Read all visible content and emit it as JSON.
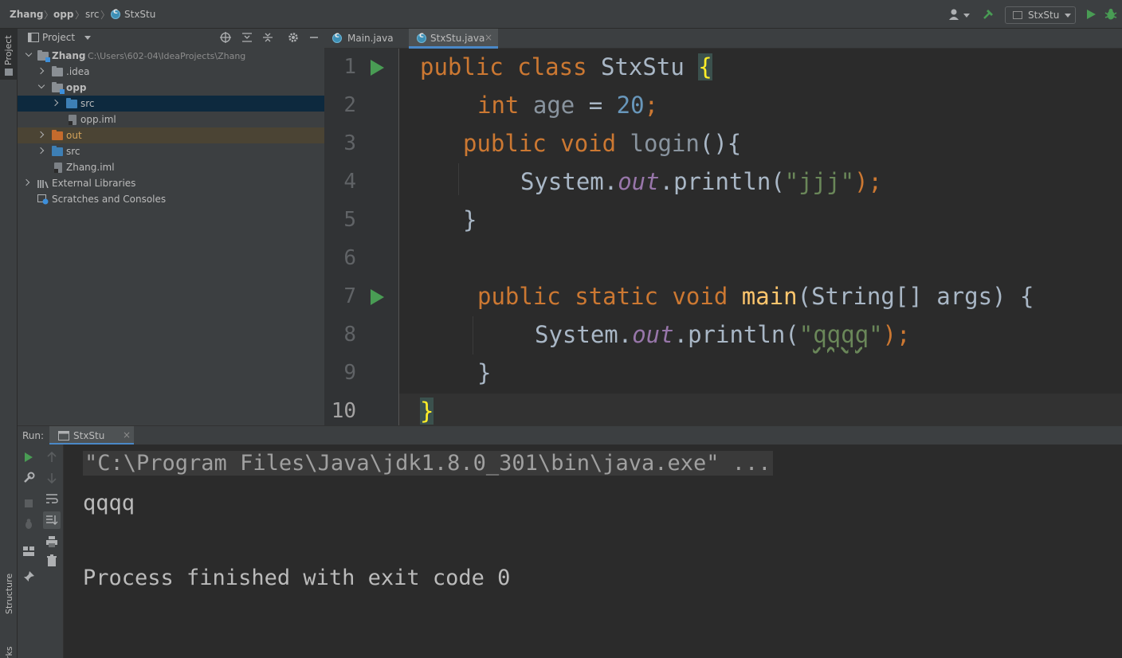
{
  "breadcrumb": {
    "items": [
      "Zhang",
      "opp",
      "src",
      "StxStu"
    ]
  },
  "toolbar": {
    "run_config": "StxStu"
  },
  "left_strip": {
    "project_tab": "Project",
    "structure_tab": "Structure",
    "bookmarks_tab": "rks"
  },
  "project_panel": {
    "title": "Project",
    "tree": [
      {
        "label": "Zhang",
        "path": "C:\\Users\\602-04\\IdeaProjects\\Zhang"
      },
      {
        "label": ".idea"
      },
      {
        "label": "opp"
      },
      {
        "label": "src"
      },
      {
        "label": "opp.iml"
      },
      {
        "label": "out"
      },
      {
        "label": "src"
      },
      {
        "label": "Zhang.iml"
      },
      {
        "label": "External Libraries"
      },
      {
        "label": "Scratches and Consoles"
      }
    ]
  },
  "editor": {
    "tabs": [
      {
        "label": "Main.java"
      },
      {
        "label": "StxStu.java"
      }
    ],
    "line_numbers": [
      "1",
      "2",
      "3",
      "4",
      "5",
      "6",
      "7",
      "8",
      "9",
      "10"
    ]
  },
  "code": {
    "l1": {
      "kw1": "public",
      "kw2": "class",
      "name": "StxStu",
      "brace": "{"
    },
    "l2": {
      "kw": "int",
      "name": "age",
      "op": " = ",
      "num": "20",
      "semi": ";"
    },
    "l3": {
      "kw1": "public",
      "kw2": "void",
      "name": "login",
      "rest": "(){"
    },
    "l4": {
      "obj": "System.",
      "field": "out",
      "call": ".println(",
      "str": "\"jjj\"",
      "end": ");"
    },
    "l5": {
      "text": "}"
    },
    "l7": {
      "kw1": "public",
      "kw2": "static",
      "kw3": "void",
      "fn": "main",
      "rest": "(String[] args) {"
    },
    "l8": {
      "obj": "System.",
      "field": "out",
      "call": ".println(",
      "str_open": "\"",
      "str_body": "qqqq",
      "str_close": "\"",
      "end": ");"
    },
    "l9": {
      "text": "}"
    },
    "l10": {
      "brace": "}"
    }
  },
  "run_panel": {
    "label": "Run:",
    "tab": "StxStu",
    "console": {
      "command": "\"C:\\Program Files\\Java\\jdk1.8.0_301\\bin\\java.exe\" ...",
      "output": "qqqq",
      "exit": "Process finished with exit code 0"
    }
  },
  "colors": {
    "keyword": "#cc7832",
    "string": "#6a8759",
    "number": "#6897bb",
    "field": "#9876aa",
    "function": "#ffc66d",
    "run_green": "#499c54",
    "accent": "#4a88c7"
  }
}
